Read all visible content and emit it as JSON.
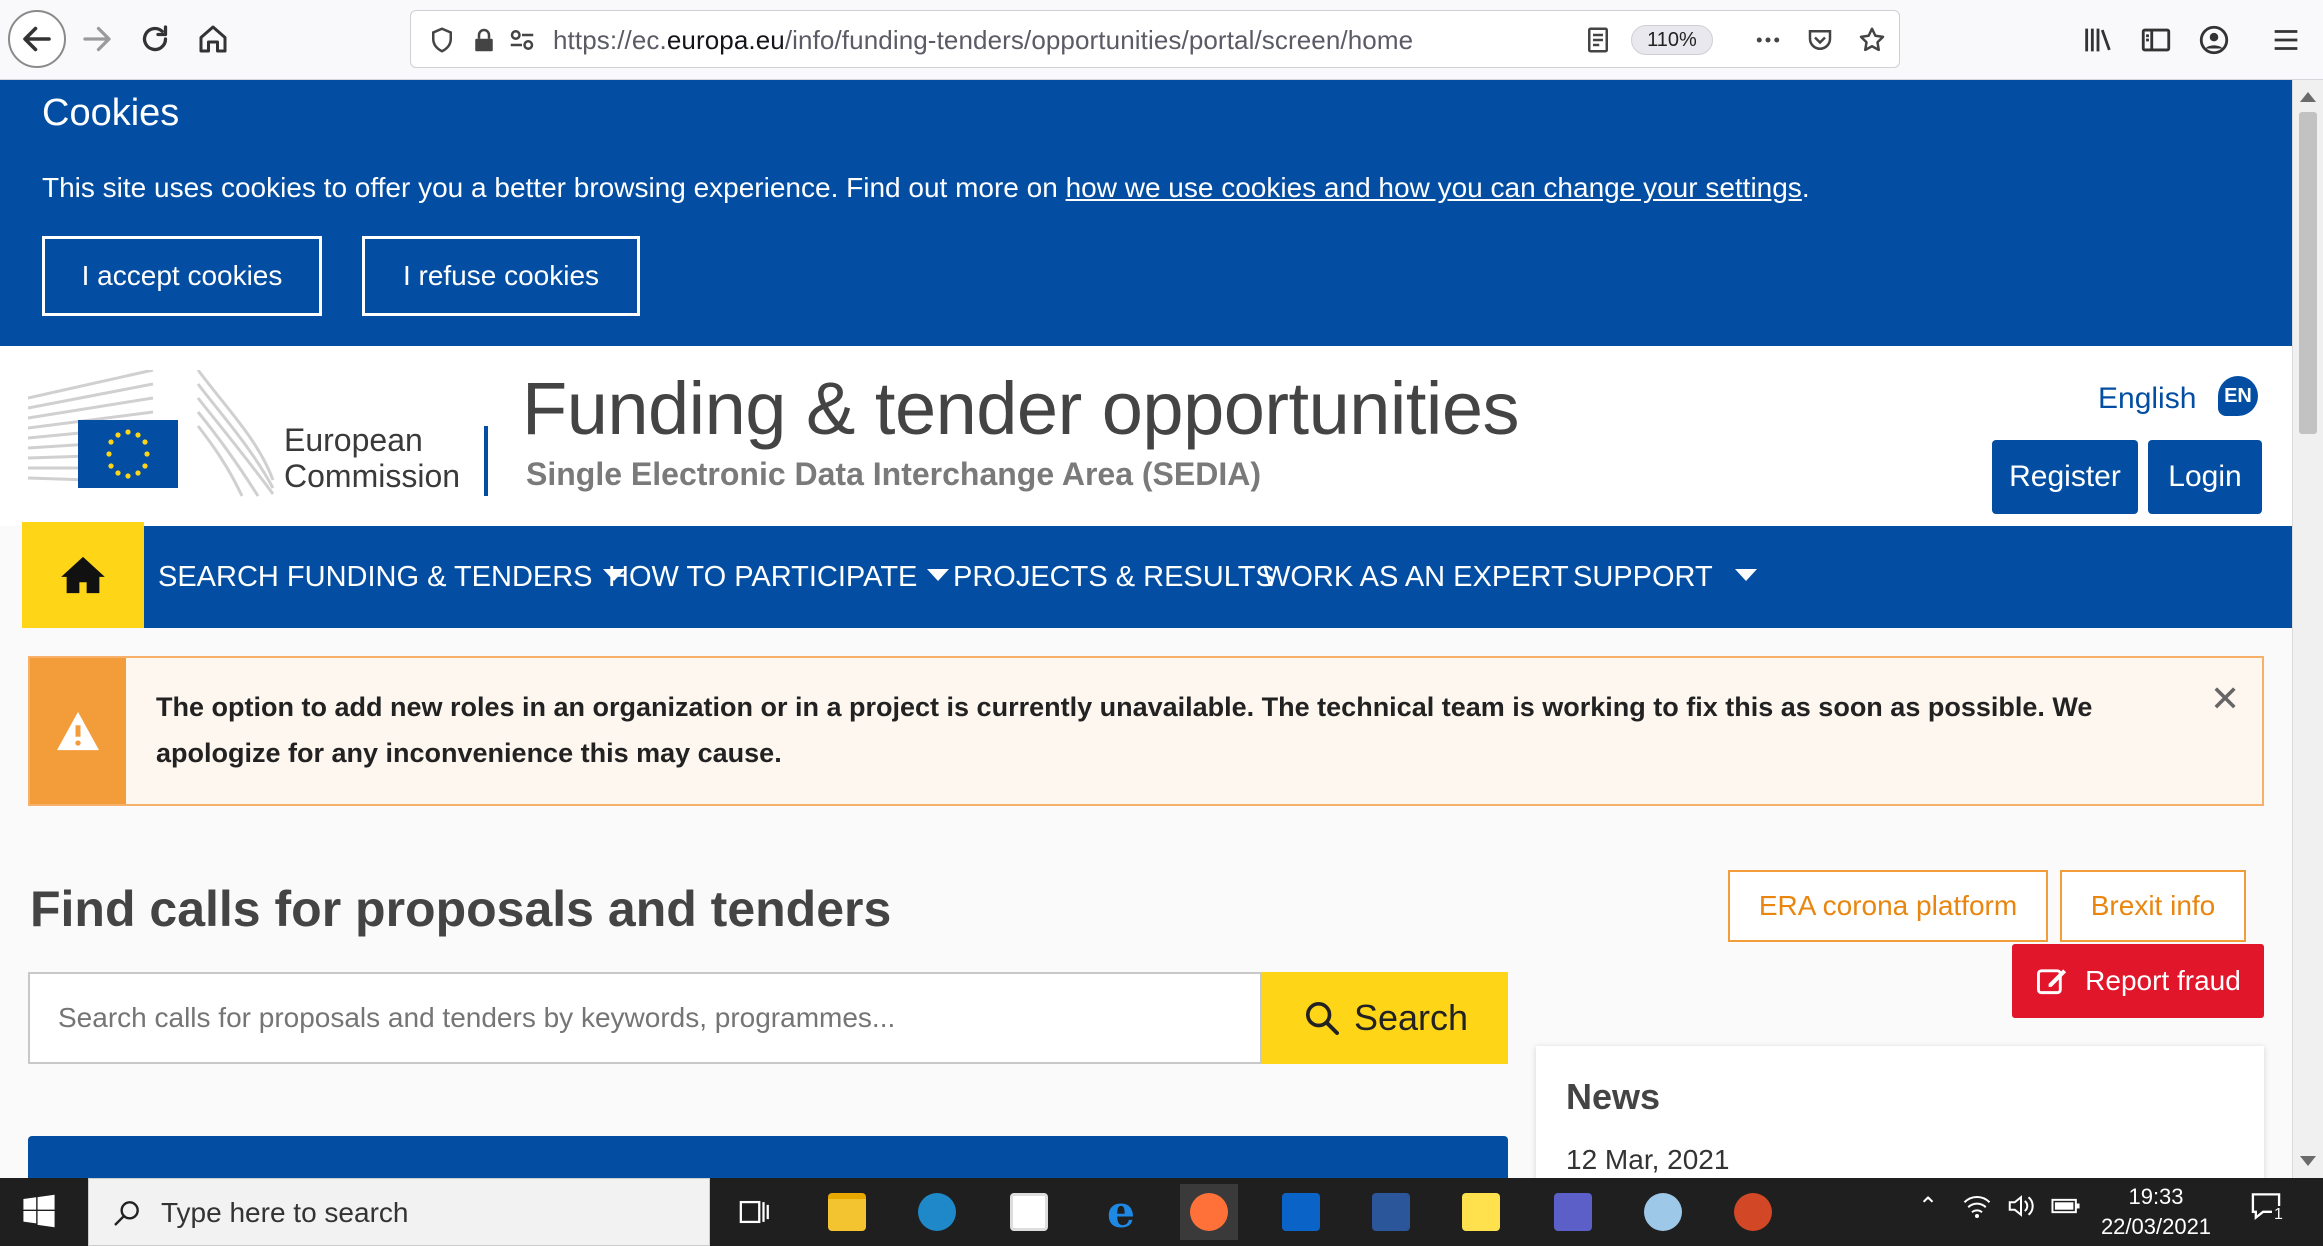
{
  "browser": {
    "url_prefix": "https://ec.",
    "url_domain": "europa.eu",
    "url_path": "/info/funding-tenders/opportunities/portal/screen/home",
    "zoom": "110%"
  },
  "cookie_banner": {
    "title": "Cookies",
    "text": "This site uses cookies to offer you a better browsing experience. Find out more on ",
    "link": "how we use cookies and how you can change your settings",
    "text_end": ".",
    "accept_label": "I accept cookies",
    "refuse_label": "I refuse cookies"
  },
  "header": {
    "ec_line1": "European",
    "ec_line2": "Commission",
    "title": "Funding & tender opportunities",
    "subtitle": "Single Electronic Data Interchange Area (SEDIA)",
    "language": "English",
    "language_code": "EN",
    "register_label": "Register",
    "login_label": "Login"
  },
  "nav": {
    "items": [
      {
        "label": "SEARCH FUNDING & TENDERS",
        "dropdown": true
      },
      {
        "label": "HOW TO PARTICIPATE",
        "dropdown": true
      },
      {
        "label": "PROJECTS & RESULTS",
        "dropdown": false
      },
      {
        "label": "WORK AS AN EXPERT",
        "dropdown": false
      },
      {
        "label": "SUPPORT",
        "dropdown": true
      }
    ]
  },
  "alert": {
    "text": "The option to add new roles in an organization or in a project is currently unavailable. The technical team is working to fix this as soon as possible. We apologize for any inconvenience this may cause."
  },
  "main": {
    "find_title": "Find calls for proposals and tenders",
    "search_placeholder": "Search calls for proposals and tenders by keywords, programmes...",
    "search_label": "Search",
    "era_label": "ERA corona platform",
    "brexit_label": "Brexit info",
    "fraud_label": "Report fraud",
    "news_title": "News",
    "news_date": "12 Mar, 2021"
  },
  "taskbar": {
    "search_text": "Type here to search",
    "time": "19:33",
    "date": "22/03/2021",
    "notification_count": "1"
  },
  "colors": {
    "ec_blue": "#034ea2",
    "yellow": "#ffd617",
    "warning_orange": "#f39c3a",
    "fraud_red": "#e2162b"
  }
}
